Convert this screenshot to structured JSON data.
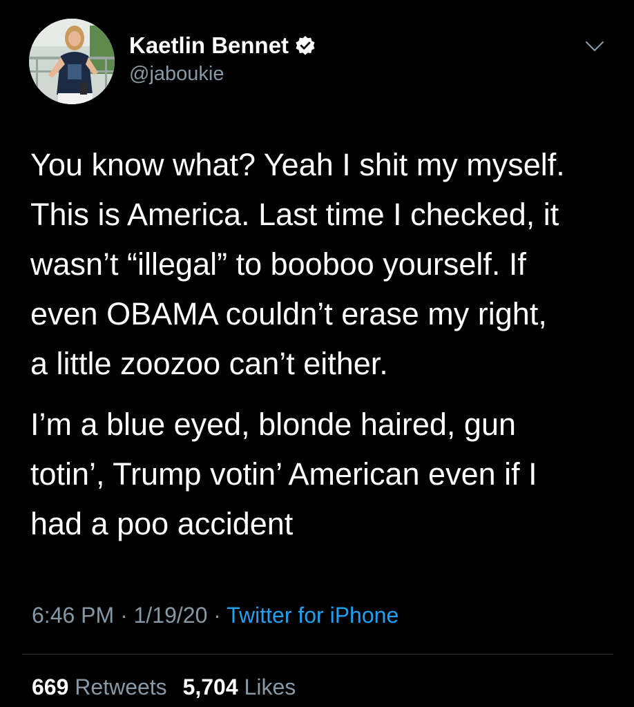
{
  "author": {
    "name": "Kaetlin Bennet",
    "handle": "@jaboukie",
    "verified": true,
    "avatar_icon": "profile-photo"
  },
  "tweet": {
    "paragraphs": [
      "You know what? Yeah I shit my myself.\nThis is America. Last time I checked, it\nwasn’t “illegal” to booboo yourself. If\neven OBAMA couldn’t erase my right,\na little zoozoo can’t either.",
      "I’m a blue eyed, blonde haired, gun\ntotin’, Trump votin’ American even if I\nhad a poo accident"
    ]
  },
  "meta": {
    "time": "6:46 PM",
    "separator": " · ",
    "date": "1/19/20",
    "source": "Twitter for iPhone"
  },
  "stats": {
    "retweets_count": "669",
    "retweets_label": "Retweets",
    "likes_count": "5,704",
    "likes_label": "Likes"
  },
  "colors": {
    "background": "#000000",
    "text": "#ffffff",
    "secondary": "#8899a6",
    "link": "#1da1f2",
    "divider": "#2f3336"
  }
}
